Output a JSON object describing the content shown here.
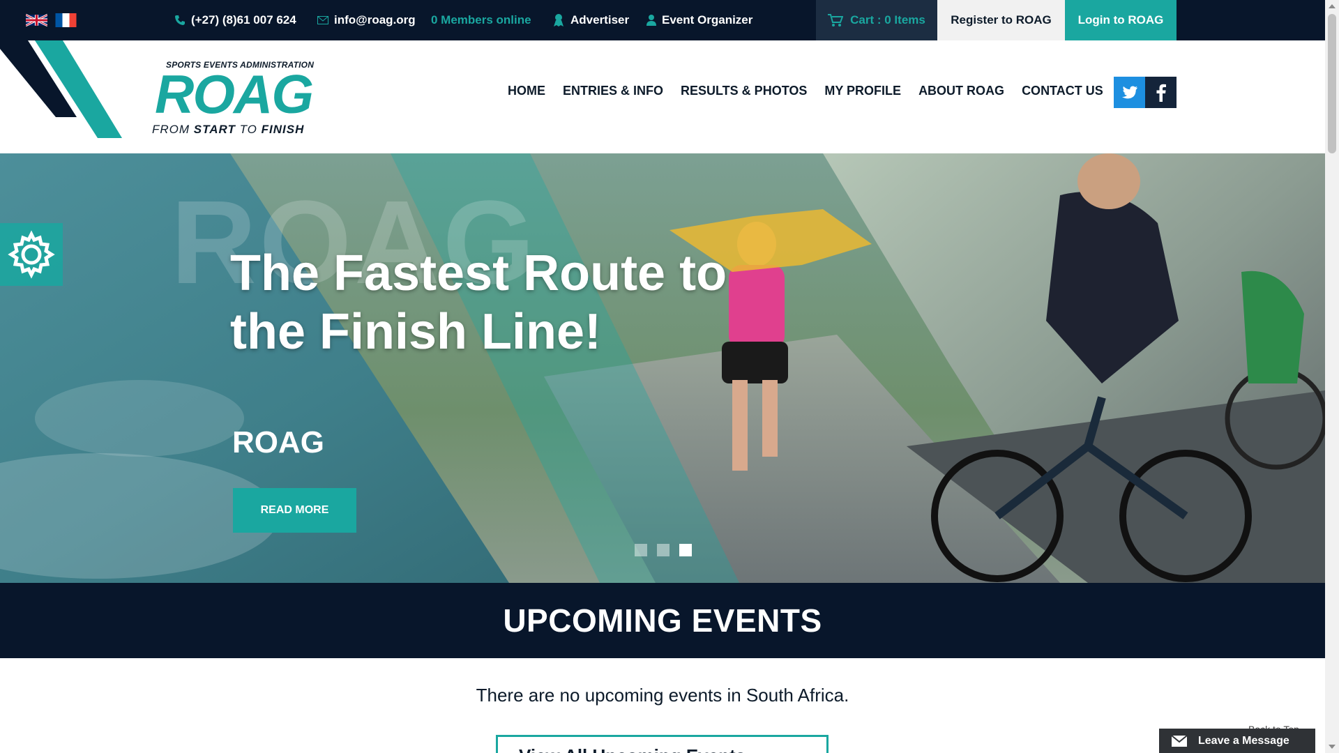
{
  "topbar": {
    "languages": [
      "en-flag-icon",
      "fr-flag-icon"
    ],
    "phone": "(+27) (8)61 007 624",
    "email": "info@roag.org",
    "members_online": "0 Members online",
    "advertiser": "Advertiser",
    "event_organizer": "Event Organizer",
    "cart": "Cart : 0 Items",
    "register": "Register to ROAG",
    "login": "Login to ROAG"
  },
  "logo": {
    "tagline": "SPORTS EVENTS ADMINISTRATION",
    "word": "ROAG",
    "sub_prefix": "FROM ",
    "sub_start": "START",
    "sub_middle": " TO ",
    "sub_finish": "FINISH"
  },
  "nav": {
    "items": [
      "HOME",
      "ENTRIES & INFO",
      "RESULTS & PHOTOS",
      "MY PROFILE",
      "ABOUT ROAG",
      "CONTACT US"
    ]
  },
  "hero": {
    "watermark": "ROAG",
    "title": "The Fastest Route to the Finish Line!",
    "subtitle": "ROAG",
    "button": "READ MORE",
    "slides_total": 3,
    "active_slide": 3
  },
  "upcoming": {
    "heading": "UPCOMING EVENTS",
    "empty_message": "There are no upcoming events in South Africa.",
    "view_all": "View All Upcoming Events"
  },
  "footer_widgets": {
    "back_to_top": "Back to Top",
    "leave_message": "Leave a Message"
  },
  "colors": {
    "navy": "#08162b",
    "teal": "#1aa7a0",
    "twitter": "#1d8fe0",
    "facebook": "#14243a"
  }
}
